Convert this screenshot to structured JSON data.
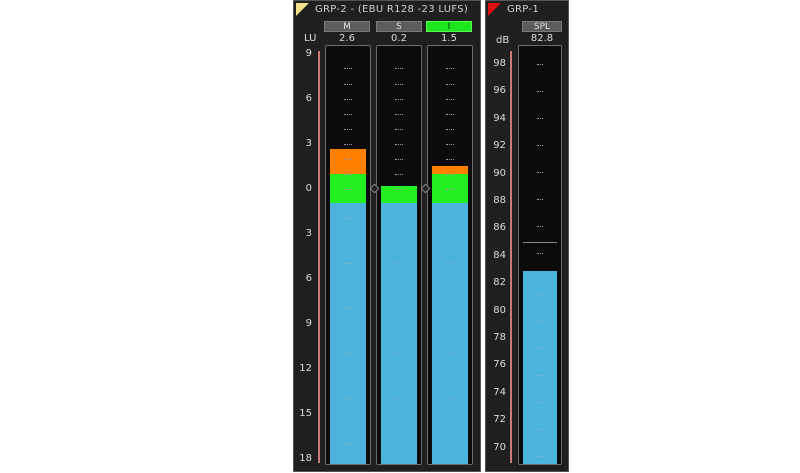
{
  "grp2": {
    "title": "GRP-2 - (EBU R128 -23 LUFS)",
    "unit": "LU",
    "ticks": [
      "9",
      "6",
      "3",
      "0",
      "3",
      "6",
      "9",
      "12",
      "15",
      "18"
    ],
    "channels": [
      {
        "label": "M",
        "value": "2.6",
        "active": false
      },
      {
        "label": "S",
        "value": "0.2",
        "active": false
      },
      {
        "label": "I",
        "value": "1.5",
        "active": true
      }
    ]
  },
  "grp1": {
    "title": "GRP-1",
    "unit": "dB",
    "ticks": [
      "98",
      "96",
      "94",
      "92",
      "90",
      "88",
      "86",
      "84",
      "82",
      "80",
      "78",
      "76",
      "74",
      "72",
      "70"
    ],
    "channels": [
      {
        "label": "SPL",
        "value": "82.8",
        "active": false
      }
    ]
  },
  "colors": {
    "panel": "#1f1f1f",
    "meter_bg": "#0b0b0b",
    "blue": "#4cb4dc",
    "green": "#22ee22",
    "orange": "#ff7f00",
    "accent": "#1ee61e",
    "corner_yellow": "#f2e38c",
    "corner_red": "#e01010"
  },
  "icons": {
    "grp2_corner": "yellow-corner-icon",
    "grp1_corner": "red-corner-icon"
  }
}
